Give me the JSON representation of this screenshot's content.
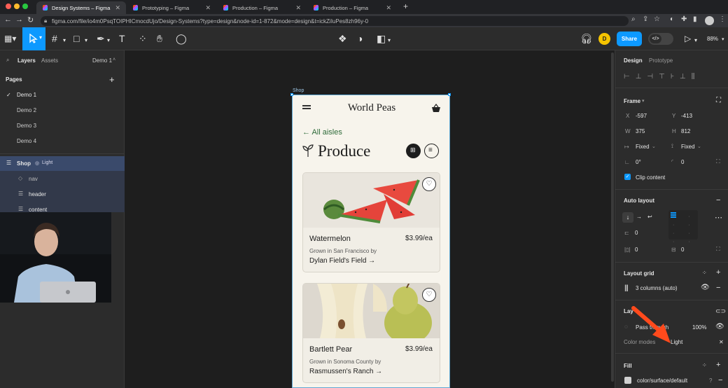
{
  "browser": {
    "tabs": [
      {
        "label": "Design Systems – Figma",
        "active": true
      },
      {
        "label": "Prototyping – Figma",
        "active": false
      },
      {
        "label": "Production – Figma",
        "active": false
      },
      {
        "label": "Production – Figma",
        "active": false
      }
    ],
    "url": "figma.com/file/io4m0PsqTOIPHICmocdUjo/Design-Systems?type=design&node-id=1-872&mode=design&t=ickZiIuPes8zh96y-0"
  },
  "toolbar": {
    "avatar_initial": "D",
    "share_label": "Share",
    "zoom": "88%"
  },
  "left_panel": {
    "tabs": {
      "layers": "Layers",
      "assets": "Assets"
    },
    "page_selector": "Demo 1",
    "pages_heading": "Pages",
    "pages": [
      "Demo 1",
      "Demo 2",
      "Demo 3",
      "Demo 4"
    ],
    "layers": {
      "frame": "Shop",
      "frame_mode": "Light",
      "children": [
        "nav",
        "header",
        "content"
      ]
    }
  },
  "canvas": {
    "frame_label": "Shop",
    "app": {
      "brand": "World Peas",
      "back_link": "← All aisles",
      "section_title": "Produce",
      "products": [
        {
          "name": "Watermelon",
          "price": "$3.99/ea",
          "origin": "Grown in San Francisco by",
          "farm": "Dylan Field's Field →"
        },
        {
          "name": "Bartlett Pear",
          "price": "$3.99/ea",
          "origin": "Grown in Sonoma County by",
          "farm": "Rasmussen's Ranch →"
        }
      ]
    }
  },
  "right_panel": {
    "tabs": {
      "design": "Design",
      "prototype": "Prototype"
    },
    "frame": {
      "heading": "Frame",
      "x_label": "X",
      "x": "-597",
      "y_label": "Y",
      "y": "-413",
      "w_label": "W",
      "w": "375",
      "h_label": "H",
      "h": "812",
      "w_mode": "Fixed",
      "h_mode": "Fixed",
      "rotation": "0°",
      "radius": "0",
      "clip_label": "Clip content"
    },
    "auto_layout": {
      "heading": "Auto layout",
      "gap": "0",
      "pad_h": "0",
      "pad_v": "0"
    },
    "layout_grid": {
      "heading": "Layout grid",
      "item": "3 columns (auto)"
    },
    "layer": {
      "heading": "Lay",
      "blend": "Pass through",
      "opacity": "100%",
      "color_modes_label": "Color modes",
      "color_mode_value": "Light"
    },
    "fill": {
      "heading": "Fill",
      "value": "color/surface/default"
    }
  },
  "colors": {
    "accent": "#0d99ff",
    "selection": "#3a4a6b",
    "app_green": "#2f6b3a",
    "arrow": "#ff4a1c"
  }
}
